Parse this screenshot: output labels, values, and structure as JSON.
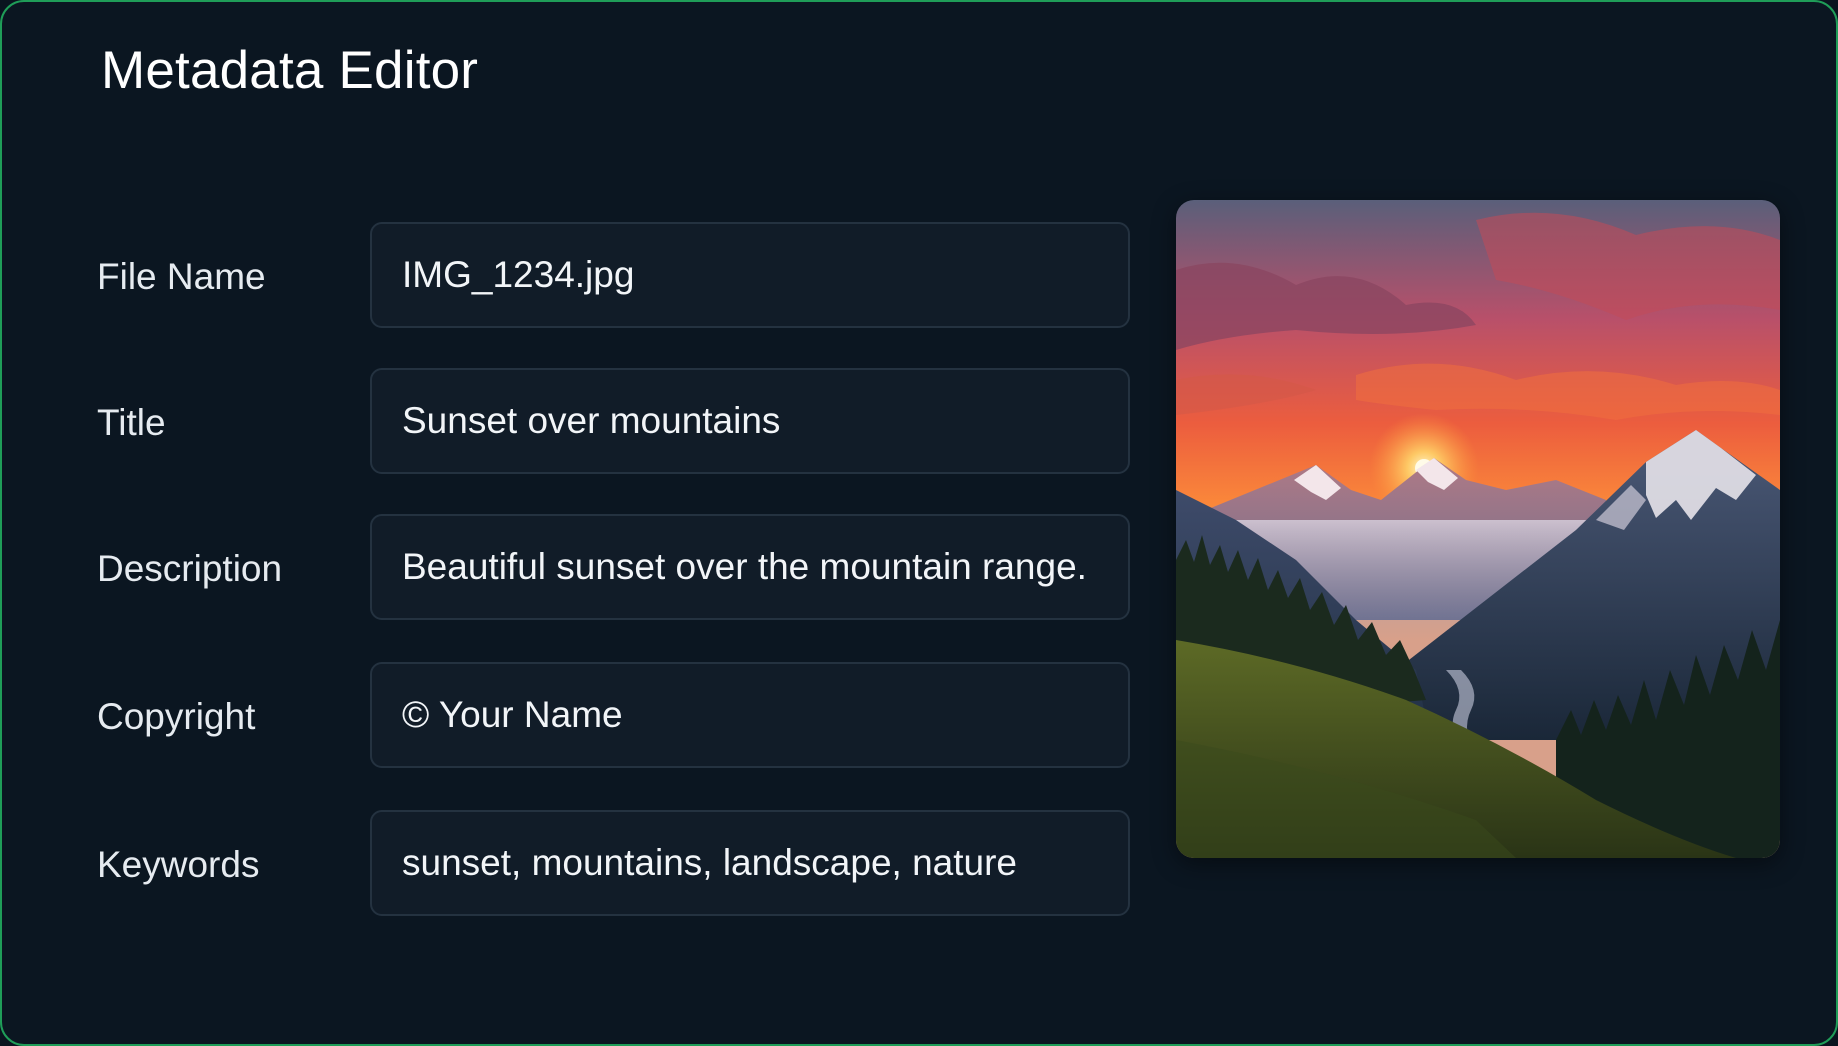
{
  "header": {
    "title": "Metadata Editor"
  },
  "fields": [
    {
      "label": "File Name",
      "value": "IMG_1234.jpg"
    },
    {
      "label": "Title",
      "value": "Sunset over mountains"
    },
    {
      "label": "Description",
      "value": "Beautiful sunset over the mountain range."
    },
    {
      "label": "Copyright",
      "value": "© Your Name"
    },
    {
      "label": "Keywords",
      "value": "sunset, mountains, landscape, nature"
    }
  ],
  "preview": {
    "subject": "mountain-sunset-photo"
  },
  "colors": {
    "accent_border": "#1f9d58",
    "background": "#0b1621",
    "field_background": "#111c28",
    "field_border": "#243240"
  }
}
